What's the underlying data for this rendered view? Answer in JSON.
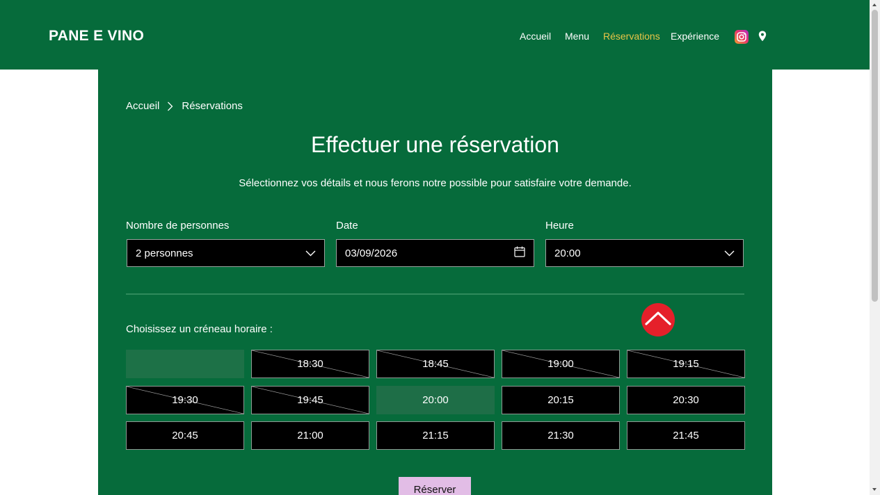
{
  "header": {
    "logo": "PANE E VINO",
    "nav": [
      "Accueil",
      "Menu",
      "Réservations",
      "Expérience"
    ],
    "active_nav": "Réservations",
    "icons": [
      "instagram-icon",
      "location-pin-icon"
    ]
  },
  "breadcrumb": {
    "home": "Accueil",
    "current": "Réservations"
  },
  "page": {
    "title": "Effectuer une réservation",
    "subtitle": "Sélectionnez vos détails et nous ferons notre possible pour satisfaire votre demande."
  },
  "form": {
    "party_size": {
      "label": "Nombre de personnes",
      "value": "2 personnes"
    },
    "date": {
      "label": "Date",
      "value": "03/09/2026"
    },
    "time": {
      "label": "Heure",
      "value": "20:00"
    }
  },
  "slots": {
    "label": "Choisissez un créneau horaire :",
    "items": [
      {
        "time": "",
        "state": "empty"
      },
      {
        "time": "18:30",
        "state": "unavailable"
      },
      {
        "time": "18:45",
        "state": "unavailable"
      },
      {
        "time": "19:00",
        "state": "unavailable"
      },
      {
        "time": "19:15",
        "state": "unavailable"
      },
      {
        "time": "19:30",
        "state": "unavailable"
      },
      {
        "time": "19:45",
        "state": "unavailable"
      },
      {
        "time": "20:00",
        "state": "selected"
      },
      {
        "time": "20:15",
        "state": "available"
      },
      {
        "time": "20:30",
        "state": "available"
      },
      {
        "time": "20:45",
        "state": "available"
      },
      {
        "time": "21:00",
        "state": "available"
      },
      {
        "time": "21:15",
        "state": "available"
      },
      {
        "time": "21:30",
        "state": "available"
      },
      {
        "time": "21:45",
        "state": "available"
      }
    ]
  },
  "reserve_button": "Réserver",
  "colors": {
    "brand_green": "#066b3b",
    "active_nav": "#e8c547",
    "scroll_top": "#e5202a",
    "reserve_button": "#e2bde6"
  }
}
